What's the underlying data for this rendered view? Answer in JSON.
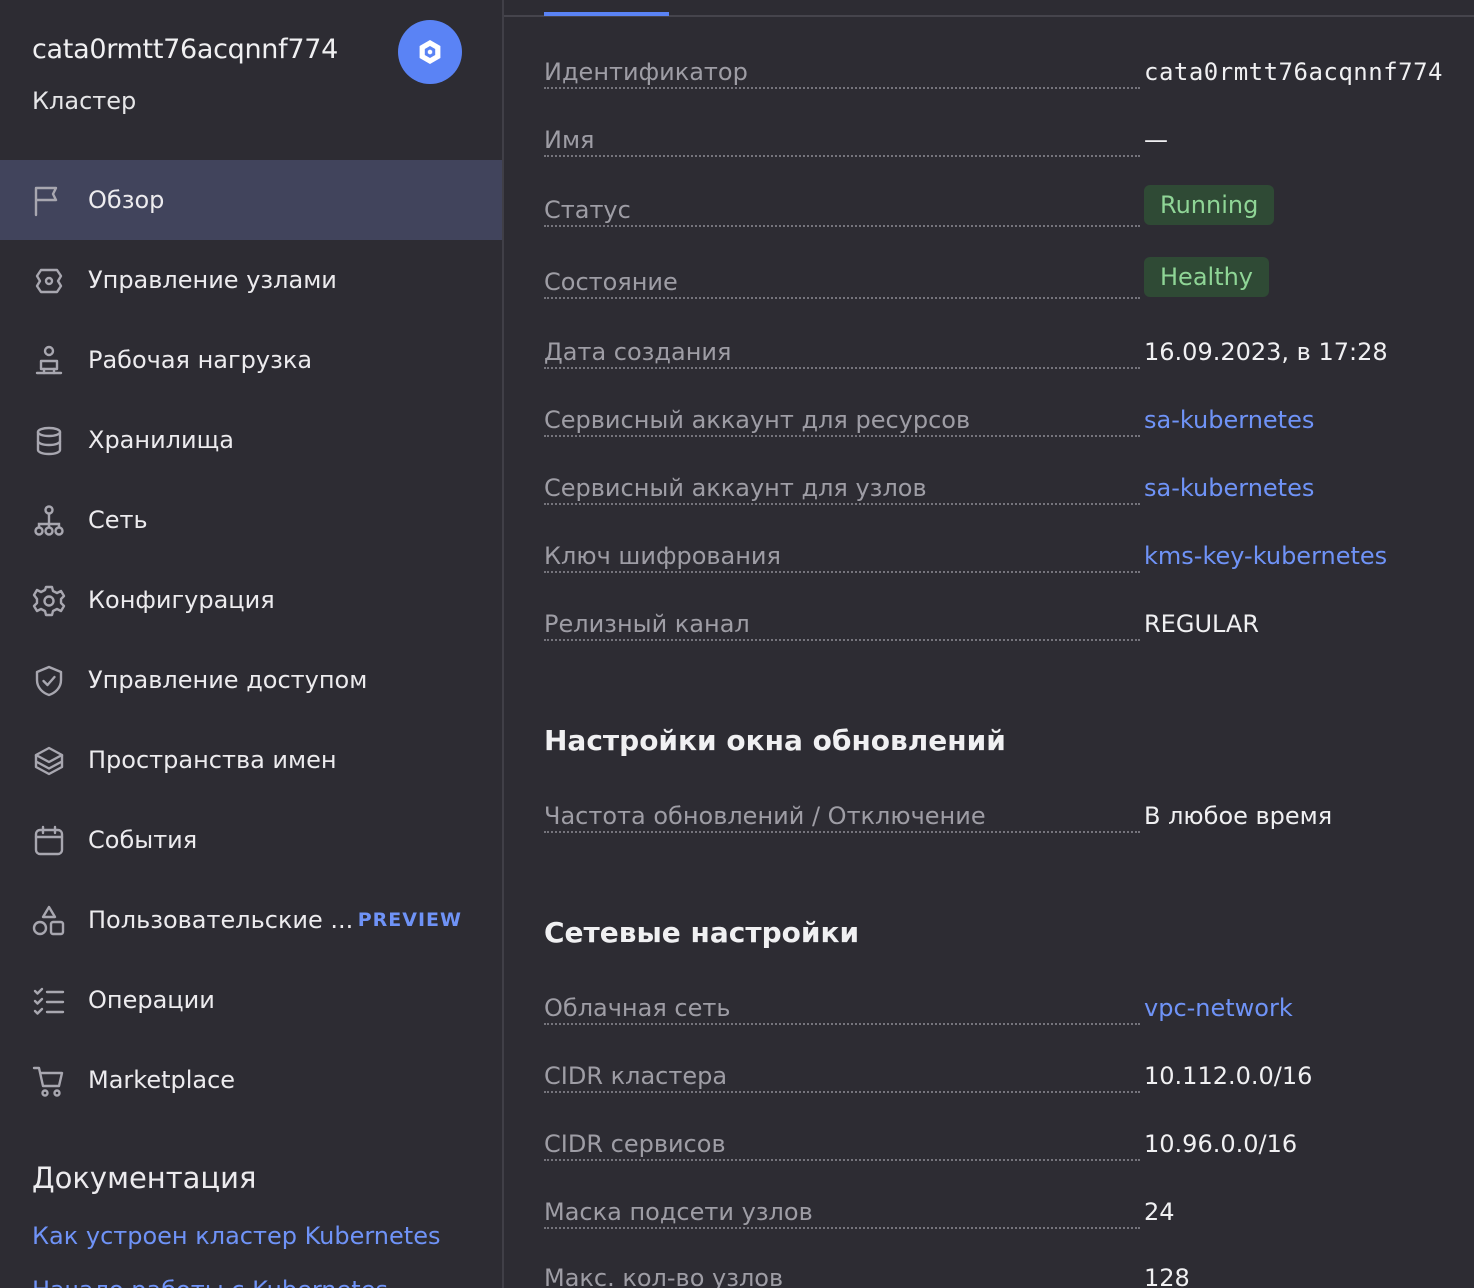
{
  "cluster": {
    "id": "cata0rmtt76acqnnf774",
    "type": "Кластер"
  },
  "nav": [
    {
      "label": "Обзор",
      "icon": "flag-icon",
      "active": true
    },
    {
      "label": "Управление узлами",
      "icon": "nodes-icon"
    },
    {
      "label": "Рабочая нагрузка",
      "icon": "workload-icon"
    },
    {
      "label": "Хранилища",
      "icon": "database-icon"
    },
    {
      "label": "Сеть",
      "icon": "network-icon"
    },
    {
      "label": "Конфигурация",
      "icon": "gear-icon"
    },
    {
      "label": "Управление доступом",
      "icon": "shield-icon"
    },
    {
      "label": "Пространства имен",
      "icon": "layers-icon"
    },
    {
      "label": "События",
      "icon": "calendar-icon"
    },
    {
      "label": "Пользовательские ...",
      "icon": "shapes-icon",
      "badge": "PREVIEW"
    },
    {
      "label": "Операции",
      "icon": "list-check-icon"
    },
    {
      "label": "Marketplace",
      "icon": "cart-icon"
    }
  ],
  "docs": {
    "title": "Документация",
    "links": [
      "Как устроен кластер Kubernetes",
      "Начало работы с Kubernetes"
    ]
  },
  "overview": {
    "rows": [
      {
        "label": "Идентификатор",
        "value": "cata0rmtt76acqnnf774",
        "kind": "mono"
      },
      {
        "label": "Имя",
        "value": "—",
        "kind": "text"
      },
      {
        "label": "Статус",
        "value": "Running",
        "kind": "badge"
      },
      {
        "label": "Состояние",
        "value": "Healthy",
        "kind": "badge"
      },
      {
        "label": "Дата создания",
        "value": "16.09.2023, в 17:28",
        "kind": "text"
      },
      {
        "label": "Сервисный аккаунт для ресурсов",
        "value": "sa-kubernetes",
        "kind": "link"
      },
      {
        "label": "Сервисный аккаунт для узлов",
        "value": "sa-kubernetes",
        "kind": "link"
      },
      {
        "label": "Ключ шифрования",
        "value": "kms-key-kubernetes",
        "kind": "link"
      },
      {
        "label": "Релизный канал",
        "value": "REGULAR",
        "kind": "text"
      }
    ]
  },
  "update_window": {
    "title": "Настройки окна обновлений",
    "rows": [
      {
        "label": "Частота обновлений / Отключение",
        "value": "В любое время",
        "kind": "text"
      }
    ]
  },
  "network": {
    "title": "Сетевые настройки",
    "rows": [
      {
        "label": "Облачная сеть",
        "value": "vpc-network",
        "kind": "link"
      },
      {
        "label": "CIDR кластера",
        "value": "10.112.0.0/16",
        "kind": "text"
      },
      {
        "label": "CIDR сервисов",
        "value": "10.96.0.0/16",
        "kind": "text"
      },
      {
        "label": "Маска подсети узлов",
        "value": "24",
        "kind": "text"
      },
      {
        "label": "Макс. кол-во узлов",
        "value": "128",
        "kind": "text"
      }
    ]
  },
  "colors": {
    "background": "#2d2c33",
    "accent": "#5a83f5",
    "link": "#6f93f7",
    "badge_bg": "#2f4a35",
    "badge_text": "#8fd596"
  }
}
